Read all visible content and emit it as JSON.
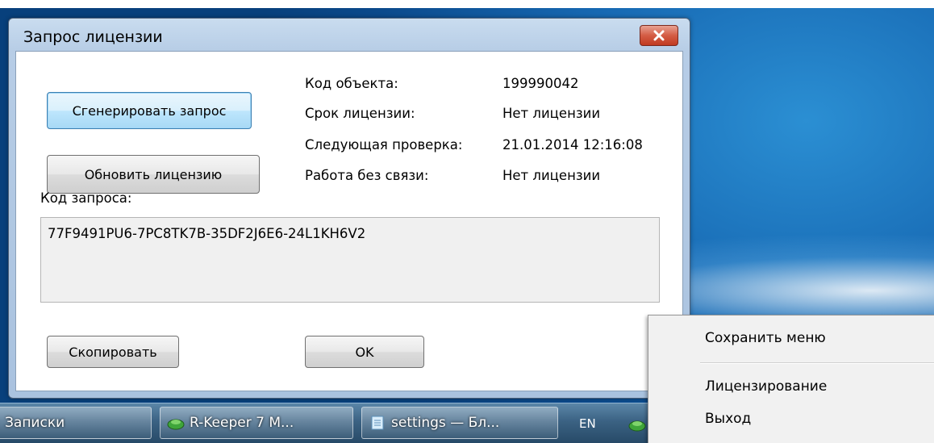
{
  "dialog": {
    "title": "Запрос лицензии",
    "generate_button": "Сгенерировать запрос",
    "refresh_button": "Обновить лицензию",
    "request_code_label": "Код запроса:",
    "request_code_value": "77F9491PU6-7PC8TK7B-35DF2J6E6-24L1KH6V2",
    "copy_button": "Скопировать",
    "ok_button": "OK",
    "info": [
      {
        "label": "Код объекта:",
        "value": "199990042"
      },
      {
        "label": "Срок лицензии:",
        "value": "Нет лицензии"
      },
      {
        "label": "Следующая проверка:",
        "value": "21.01.2014 12:16:08"
      },
      {
        "label": "Работа без связи:",
        "value": "Нет лицензии"
      }
    ]
  },
  "taskbar": {
    "items": [
      {
        "label": "Записки"
      },
      {
        "label": "R-Keeper 7 M..."
      },
      {
        "label": "settings — Бл..."
      }
    ],
    "language": "EN"
  },
  "context_menu": {
    "items": [
      "Сохранить меню",
      "Лицензирование",
      "Выход"
    ]
  },
  "colors": {
    "close_button": "#c13b22",
    "taskbar": "#3b6283",
    "desktop": "#1769b3"
  }
}
